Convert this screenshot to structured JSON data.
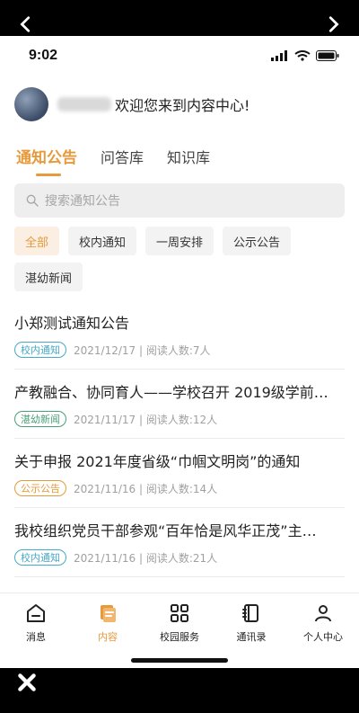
{
  "status": {
    "time": "9:02"
  },
  "header": {
    "welcome": "欢迎您来到内容中心!"
  },
  "tabs": [
    {
      "label": "通知公告",
      "active": true
    },
    {
      "label": "问答库",
      "active": false
    },
    {
      "label": "知识库",
      "active": false
    }
  ],
  "search": {
    "placeholder": "搜索通知公告"
  },
  "filters": [
    {
      "label": "全部",
      "active": true
    },
    {
      "label": "校内通知",
      "active": false
    },
    {
      "label": "一周安排",
      "active": false
    },
    {
      "label": "公示公告",
      "active": false
    },
    {
      "label": "湛幼新闻",
      "active": false
    }
  ],
  "items": [
    {
      "title": "小郑测试通知公告",
      "tag": "校内通知",
      "tag_color": "#46a9c9",
      "meta": "2021/12/17 | 阅读人数:7人"
    },
    {
      "title": "产教融合、协同育人——学校召开 2019级学前…",
      "tag": "湛幼新闻",
      "tag_color": "#4aa076",
      "meta": "2021/11/17 | 阅读人数:12人"
    },
    {
      "title": "关于申报 2021年度省级“巾帼文明岗”的通知",
      "tag": "公示公告",
      "tag_color": "#e79a3c",
      "meta": "2021/11/16 | 阅读人数:14人"
    },
    {
      "title": "我校组织党员干部参观“百年恰是风华正茂”主…",
      "tag": "校内通知",
      "tag_color": "#46a9c9",
      "meta": "2021/11/16 | 阅读人数:21人"
    }
  ],
  "bottom_nav": [
    {
      "label": "消息",
      "icon": "home-icon",
      "active": false
    },
    {
      "label": "内容",
      "icon": "content-icon",
      "active": true
    },
    {
      "label": "校园服务",
      "icon": "grid-icon",
      "active": false
    },
    {
      "label": "通讯录",
      "icon": "contacts-icon",
      "active": false
    },
    {
      "label": "个人中心",
      "icon": "user-icon",
      "active": false
    }
  ],
  "colors": {
    "accent": "#e79a3c"
  }
}
